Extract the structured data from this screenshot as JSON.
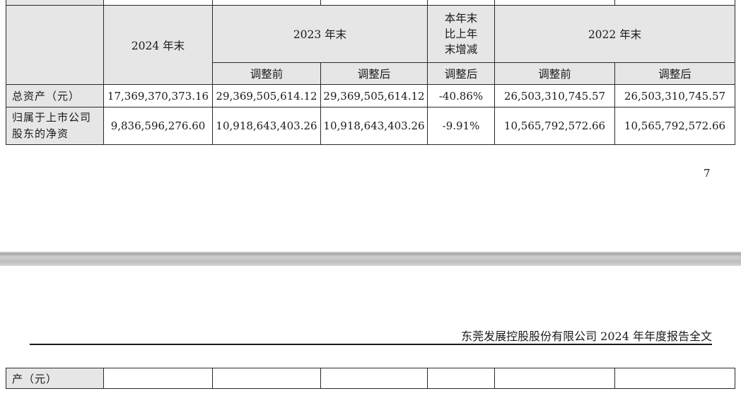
{
  "table": {
    "header": {
      "col_2024": "2024 年末",
      "col_2023": "2023 年末",
      "col_change": "本年末比上年末增减",
      "col_2022": "2022 年末",
      "sub_before": "调整前",
      "sub_after": "调整后",
      "sub_change": "调整后"
    },
    "rows": [
      {
        "label": "总资产（元）",
        "v2024": "17,369,370,373.16",
        "v2023_before": "29,369,505,614.12",
        "v2023_after": "29,369,505,614.12",
        "change": "-40.86%",
        "v2022_before": "26,503,310,745.57",
        "v2022_after": "26,503,310,745.57"
      },
      {
        "label": "归属于上市公司股东的净资",
        "v2024": "9,836,596,276.60",
        "v2023_before": "10,918,643,403.26",
        "v2023_after": "10,918,643,403.26",
        "change": "-9.91%",
        "v2022_before": "10,565,792,572.66",
        "v2022_after": "10,565,792,572.66"
      }
    ]
  },
  "page_number": "7",
  "running_header": "东莞发展控股股份有限公司 2024 年年度报告全文",
  "continued_row": {
    "label": "产（元）"
  }
}
